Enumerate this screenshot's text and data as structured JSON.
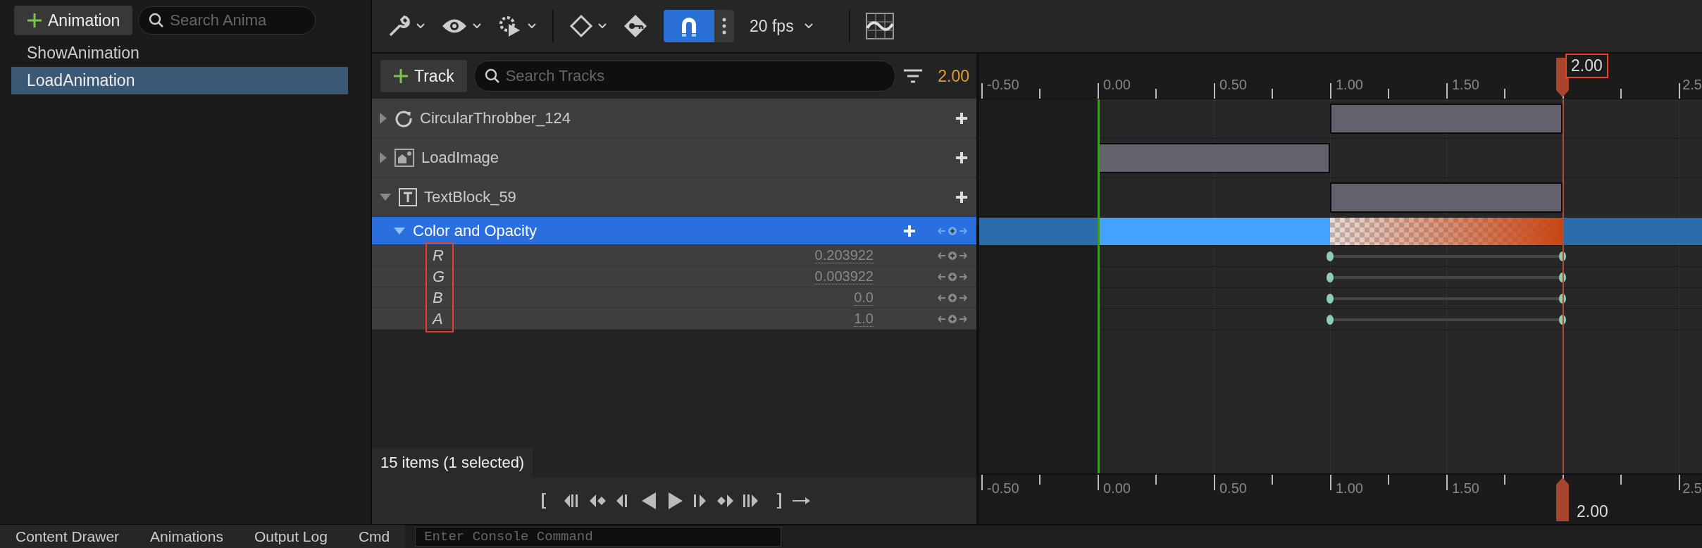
{
  "left_panel": {
    "add_button": "Animation",
    "search_placeholder": "Search Anima",
    "animations": [
      {
        "label": "ShowAnimation",
        "selected": false
      },
      {
        "label": "LoadAnimation",
        "selected": true
      }
    ]
  },
  "toolbar": {
    "snap_on": true,
    "frame_rate": "20 fps"
  },
  "track_header": {
    "add_button": "Track",
    "search_placeholder": "Search Tracks",
    "current_time": "2.00"
  },
  "tracks": [
    {
      "label": "CircularThrobber_124",
      "kind": "throbber",
      "expanded": false,
      "selected": false
    },
    {
      "label": "LoadImage",
      "kind": "image",
      "expanded": false,
      "selected": false
    },
    {
      "label": "TextBlock_59",
      "kind": "text",
      "expanded": true,
      "selected": false,
      "children": [
        {
          "label": "Color and Opacity",
          "kind": "property",
          "expanded": true,
          "selected": true,
          "children": [
            {
              "label": "R",
              "kind": "channel",
              "value": "0.203922",
              "selected": false
            },
            {
              "label": "G",
              "kind": "channel",
              "value": "0.003922",
              "selected": false
            },
            {
              "label": "B",
              "kind": "channel",
              "value": "0.0",
              "selected": false
            },
            {
              "label": "A",
              "kind": "channel",
              "value": "1.0",
              "selected": false
            }
          ]
        }
      ]
    }
  ],
  "channel_labels_annotated": true,
  "status": "15 items (1 selected)",
  "timeline": {
    "ruler_labels": [
      "-0.50",
      "0.00",
      "0.50",
      "1.00",
      "1.50",
      "2.5"
    ],
    "bottom_ruler_labels": [
      "-0.50",
      "0.00",
      "0.50",
      "1.00",
      "1.50",
      "2.5"
    ],
    "playhead_top": {
      "label": "2.00",
      "annotated": true
    },
    "playhead_bottom": {
      "label": "2.00",
      "annotated": false
    }
  },
  "bottom_bar": {
    "tabs": [
      "Content Drawer",
      "Animations",
      "Output Log",
      "Cmd"
    ],
    "console_placeholder": "Enter Console Command"
  }
}
